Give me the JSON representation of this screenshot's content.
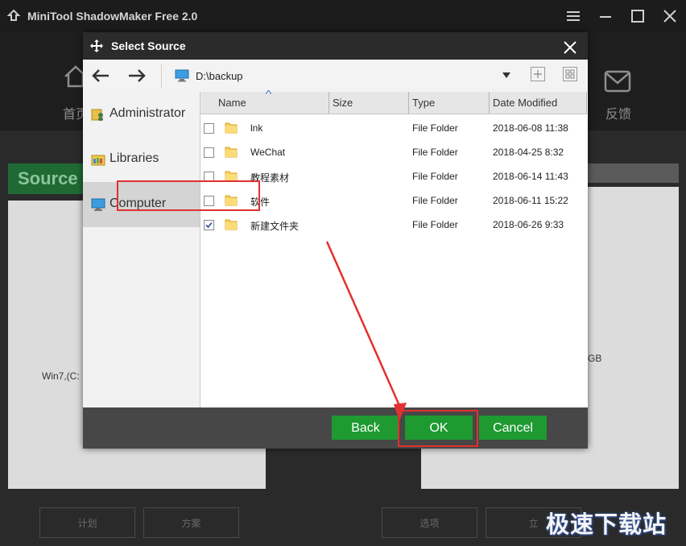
{
  "app": {
    "title": "MiniTool ShadowMaker Free 2.0",
    "nav_home": "首页",
    "nav_feedback": "反馈",
    "source_tab": "Source",
    "source_item": "Win7,(C:",
    "dest_size": "GB",
    "bottom_buttons": [
      "计划",
      "方案",
      "选项",
      "立"
    ]
  },
  "dialog": {
    "title": "Select Source",
    "path": "D:\\backup",
    "sidebar": [
      {
        "label": "Administrator",
        "icon": "user-folder-icon",
        "selected": false
      },
      {
        "label": "Libraries",
        "icon": "libraries-icon",
        "selected": false
      },
      {
        "label": "Computer",
        "icon": "computer-icon",
        "selected": true
      }
    ],
    "columns": [
      "Name",
      "Size",
      "Type",
      "Date Modified"
    ],
    "files": [
      {
        "name": "lnk",
        "size": "",
        "type": "File Folder",
        "date": "2018-06-08 11:38",
        "checked": false
      },
      {
        "name": "WeChat",
        "size": "",
        "type": "File Folder",
        "date": "2018-04-25 8:32",
        "checked": false
      },
      {
        "name": "教程素材",
        "size": "",
        "type": "File Folder",
        "date": "2018-06-14 11:43",
        "checked": false
      },
      {
        "name": "软件",
        "size": "",
        "type": "File Folder",
        "date": "2018-06-11 15:22",
        "checked": false
      },
      {
        "name": "新建文件夹",
        "size": "",
        "type": "File Folder",
        "date": "2018-06-26 9:33",
        "checked": true
      }
    ],
    "buttons": {
      "back": "Back",
      "ok": "OK",
      "cancel": "Cancel"
    }
  },
  "watermark": "极速下载站",
  "colors": {
    "accent_green": "#1e9a31",
    "highlight_red": "#e23030",
    "title_bg": "#2b2b2b"
  }
}
